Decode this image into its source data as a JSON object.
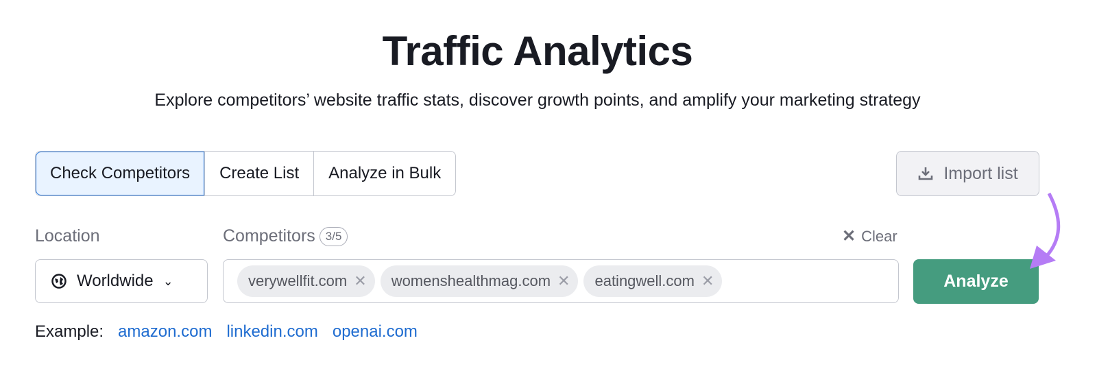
{
  "title": "Traffic Analytics",
  "subtitle": "Explore competitors’ website traffic stats, discover growth points, and amplify your marketing strategy",
  "tabs": [
    {
      "label": "Check Competitors",
      "active": true
    },
    {
      "label": "Create List"
    },
    {
      "label": "Analyze in Bulk"
    }
  ],
  "import_label": "Import list",
  "location": {
    "label": "Location",
    "value": "Worldwide",
    "icon": "globe-icon"
  },
  "competitors": {
    "label": "Competitors",
    "count": "3/5",
    "chips": [
      "verywellfit.com",
      "womenshealthmag.com",
      "eatingwell.com"
    ],
    "clear_label": "Clear"
  },
  "analyze_label": "Analyze",
  "example": {
    "label": "Example:",
    "links": [
      "amazon.com",
      "linkedin.com",
      "openai.com"
    ]
  },
  "colors": {
    "accent": "#459c7f",
    "link": "#1f6cd0",
    "annotation_arrow": "#b57cf5"
  }
}
